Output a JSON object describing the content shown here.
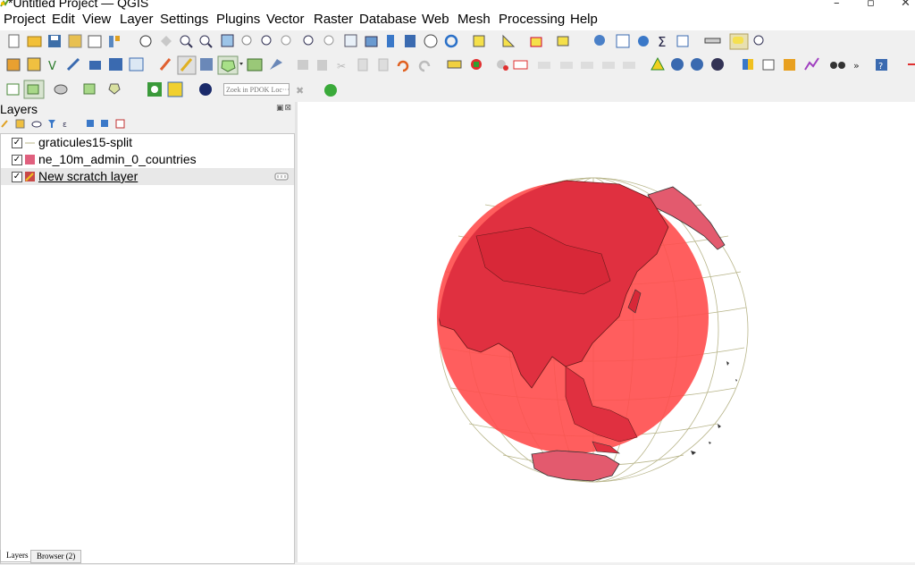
{
  "window": {
    "title": "*Untitled Project — QGIS",
    "controls": [
      "–",
      "▫",
      "✕"
    ]
  },
  "menubar": {
    "items": [
      "Project",
      "Edit",
      "View",
      "Layer",
      "Settings",
      "Plugins",
      "Vector",
      "Raster",
      "Database",
      "Web",
      "Mesh",
      "Processing",
      "Help"
    ]
  },
  "toolbar": {
    "pdok_search_placeholder": "Zoek in PDOK Loc···"
  },
  "layers_panel": {
    "title": "Layers",
    "close_glyphs": "▣⊠",
    "layers": [
      {
        "name": "graticules15-split",
        "checked": true,
        "symbol": "line-icon",
        "selected": false
      },
      {
        "name": "ne_10m_admin_0_countries",
        "checked": true,
        "symbol": "polygon-fill-icon",
        "color": "#e0607e",
        "selected": false
      },
      {
        "name": "New scratch layer",
        "checked": true,
        "symbol": "edit-polygon-icon",
        "selected": true
      }
    ],
    "check_mark": "✓"
  },
  "bottom_tabs": [
    "Layers",
    "Browser (2)"
  ],
  "map": {
    "globe_fill": "#ff4d4d",
    "land_fill": "#e35a6e",
    "graticule_color": "#b8b58a"
  }
}
